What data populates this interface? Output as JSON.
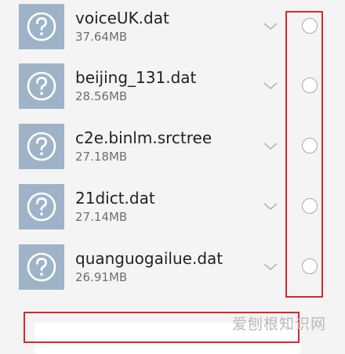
{
  "files": [
    {
      "name": "voiceUK.dat",
      "size": "37.64MB",
      "icon": "question-mark-icon"
    },
    {
      "name": "beijing_131.dat",
      "size": "28.56MB",
      "icon": "question-mark-icon"
    },
    {
      "name": "c2e.binlm.srctree",
      "size": "27.18MB",
      "icon": "question-mark-icon"
    },
    {
      "name": "21dict.dat",
      "size": "27.14MB",
      "icon": "question-mark-icon"
    },
    {
      "name": "quanguogailue.dat",
      "size": "26.91MB",
      "icon": "question-mark-icon"
    }
  ],
  "colors": {
    "highlight": "#d9262c",
    "icon_bg": "#9fb3c8",
    "page_bg": "#f4f4f4"
  },
  "watermark": "爱刨根知识网"
}
